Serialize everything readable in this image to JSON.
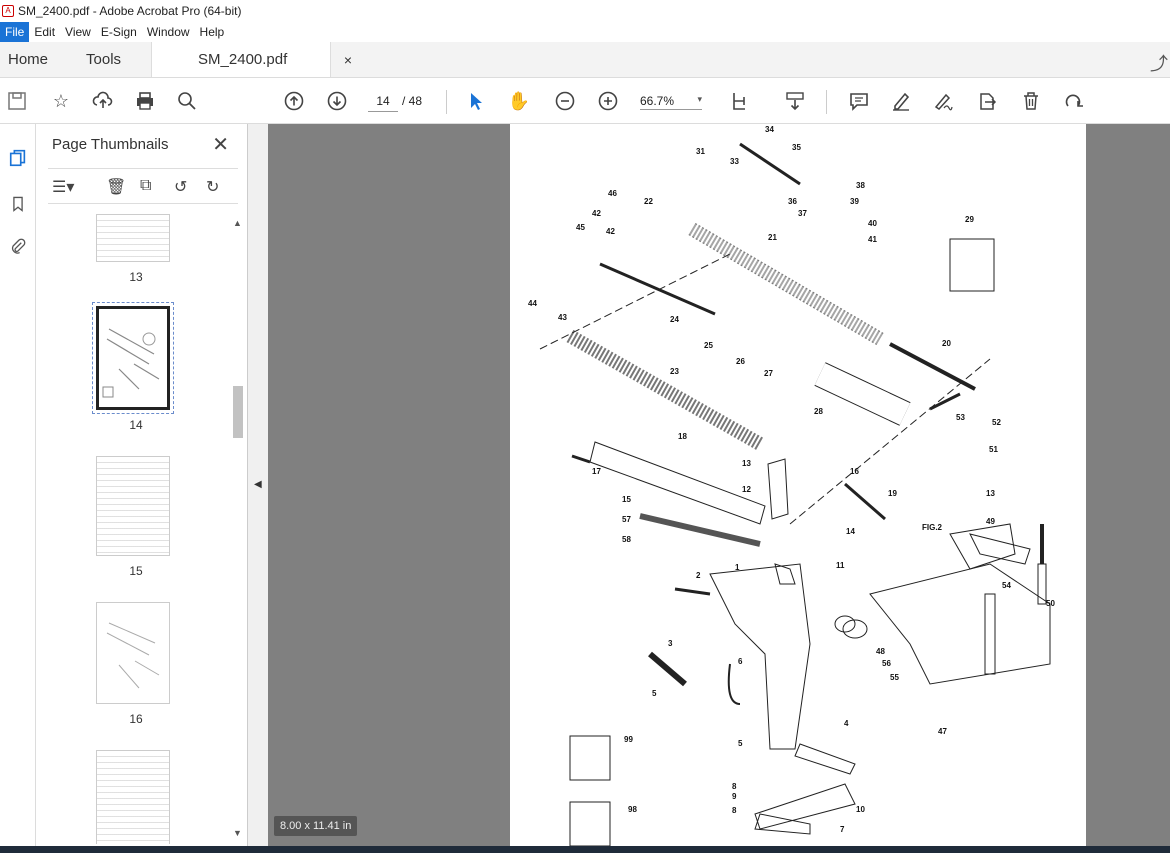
{
  "window": {
    "title": "SM_2400.pdf - Adobe Acrobat Pro (64-bit)"
  },
  "menu": [
    "File",
    "Edit",
    "View",
    "E-Sign",
    "Window",
    "Help"
  ],
  "tabs": {
    "home": "Home",
    "tools": "Tools",
    "document": "SM_2400.pdf",
    "close": "×"
  },
  "toolbar": {
    "current_page": "14",
    "total_pages": "/ 48",
    "zoom": "66.7%",
    "zoom_arrow": "▾"
  },
  "sidebar": {
    "title": "Page Thumbnails",
    "close": "✕",
    "thumbnails": [
      {
        "label": "13"
      },
      {
        "label": "14",
        "selected": true
      },
      {
        "label": "15"
      },
      {
        "label": "16"
      },
      {
        "label": ""
      }
    ]
  },
  "document": {
    "page_size": "8.00 x 11.41 in",
    "fig_label": "FIG.2",
    "part_labels": [
      "31",
      "33",
      "34",
      "35",
      "36",
      "37",
      "38",
      "39",
      "40",
      "41",
      "29",
      "46",
      "22",
      "42",
      "45",
      "21",
      "42",
      "44",
      "43",
      "24",
      "25",
      "26",
      "27",
      "20",
      "23",
      "28",
      "53",
      "52",
      "51",
      "18",
      "13",
      "16",
      "17",
      "12",
      "19",
      "13",
      "15",
      "57",
      "58",
      "14",
      "49",
      "FIG.2",
      "11",
      "1",
      "2",
      "54",
      "50",
      "3",
      "48",
      "56",
      "55",
      "6",
      "5",
      "47",
      "4",
      "99",
      "5",
      "8",
      "9",
      "8",
      "10",
      "98",
      "7"
    ]
  },
  "colors": {
    "accent": "#1a73d6",
    "viewer_bg": "#808080"
  }
}
